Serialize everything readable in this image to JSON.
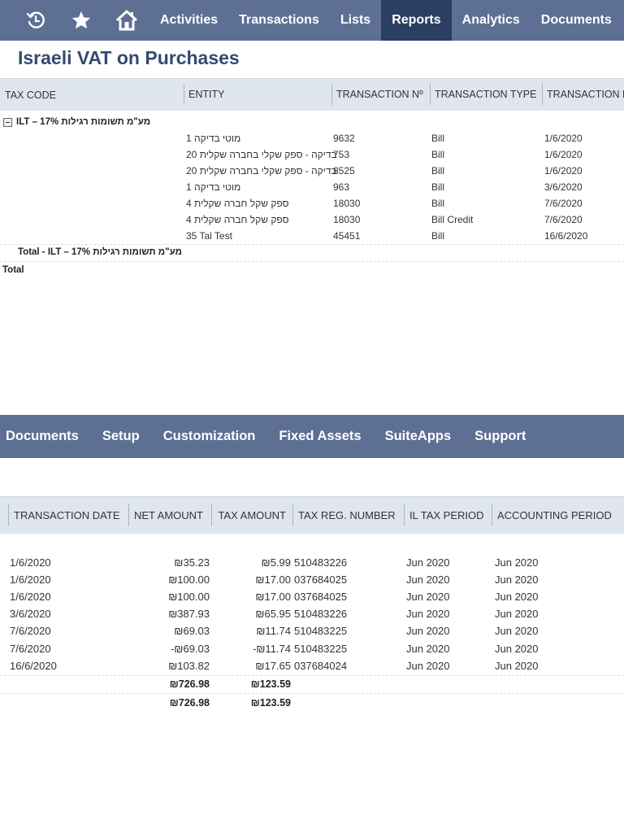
{
  "nav": {
    "icons": [
      "recent-records-icon",
      "favorites-star-icon",
      "home-icon"
    ],
    "links": [
      {
        "label": "Activities",
        "active": false
      },
      {
        "label": "Transactions",
        "active": false
      },
      {
        "label": "Lists",
        "active": false
      },
      {
        "label": "Reports",
        "active": true
      },
      {
        "label": "Analytics",
        "active": false
      },
      {
        "label": "Documents",
        "active": false
      }
    ]
  },
  "page": {
    "title": "Israeli VAT on Purchases"
  },
  "table1": {
    "headers": [
      "TAX CODE",
      "ENTITY",
      "TRANSACTION Nº",
      "TRANSACTION TYPE",
      "TRANSACTION D"
    ],
    "group_label": "ILT – 17% מע\"מ תשומות רגילות",
    "rows": [
      {
        "entity": "מוטי בדיקה 1",
        "number": "9632",
        "type": "Bill",
        "date": "1/6/2020"
      },
      {
        "entity": "בדיקה - ספק שקלי בחברה שקלית 20",
        "number": "753",
        "type": "Bill",
        "date": "1/6/2020"
      },
      {
        "entity": "בדיקה - ספק שקלי בחברה שקלית 20",
        "number": "8525",
        "type": "Bill",
        "date": "1/6/2020"
      },
      {
        "entity": "מוטי בדיקה 1",
        "number": "963",
        "type": "Bill",
        "date": "3/6/2020"
      },
      {
        "entity": "ספק שקל חברה שקלית 4",
        "number": "18030",
        "type": "Bill",
        "date": "7/6/2020"
      },
      {
        "entity": "ספק שקל חברה שקלית 4",
        "number": "18030",
        "type": "Bill Credit",
        "date": "7/6/2020"
      },
      {
        "entity": "35 Tal Test",
        "number": "45451",
        "type": "Bill",
        "date": "16/6/2020"
      }
    ],
    "group_total_label": "Total - ILT – 17% מע\"מ תשומות רגילות",
    "grand_total_label": "Total"
  },
  "nav2": {
    "links": [
      "Documents",
      "Setup",
      "Customization",
      "Fixed Assets",
      "SuiteApps",
      "Support"
    ]
  },
  "table2": {
    "headers": [
      "TRANSACTION DATE",
      "NET AMOUNT",
      "TAX AMOUNT",
      "TAX REG. NUMBER",
      "IL TAX PERIOD",
      "ACCOUNTING PERIOD"
    ],
    "rows": [
      {
        "date": "1/6/2020",
        "net": "₪35.23",
        "tax": "₪5.99",
        "reg": "510483226",
        "il_period": "Jun 2020",
        "acc_period": "Jun 2020"
      },
      {
        "date": "1/6/2020",
        "net": "₪100.00",
        "tax": "₪17.00",
        "reg": "037684025",
        "il_period": "Jun 2020",
        "acc_period": "Jun 2020"
      },
      {
        "date": "1/6/2020",
        "net": "₪100.00",
        "tax": "₪17.00",
        "reg": "037684025",
        "il_period": "Jun 2020",
        "acc_period": "Jun 2020"
      },
      {
        "date": "3/6/2020",
        "net": "₪387.93",
        "tax": "₪65.95",
        "reg": "510483226",
        "il_period": "Jun 2020",
        "acc_period": "Jun 2020"
      },
      {
        "date": "7/6/2020",
        "net": "₪69.03",
        "tax": "₪11.74",
        "reg": "510483225",
        "il_period": "Jun 2020",
        "acc_period": "Jun 2020"
      },
      {
        "date": "7/6/2020",
        "net": "-₪69.03",
        "tax": "-₪11.74",
        "reg": "510483225",
        "il_period": "Jun 2020",
        "acc_period": "Jun 2020"
      },
      {
        "date": "16/6/2020",
        "net": "₪103.82",
        "tax": "₪17.65",
        "reg": "037684024",
        "il_period": "Jun 2020",
        "acc_period": "Jun 2020"
      }
    ],
    "group_total": {
      "net": "₪726.98",
      "tax": "₪123.59"
    },
    "grand_total": {
      "net": "₪726.98",
      "tax": "₪123.59"
    }
  }
}
